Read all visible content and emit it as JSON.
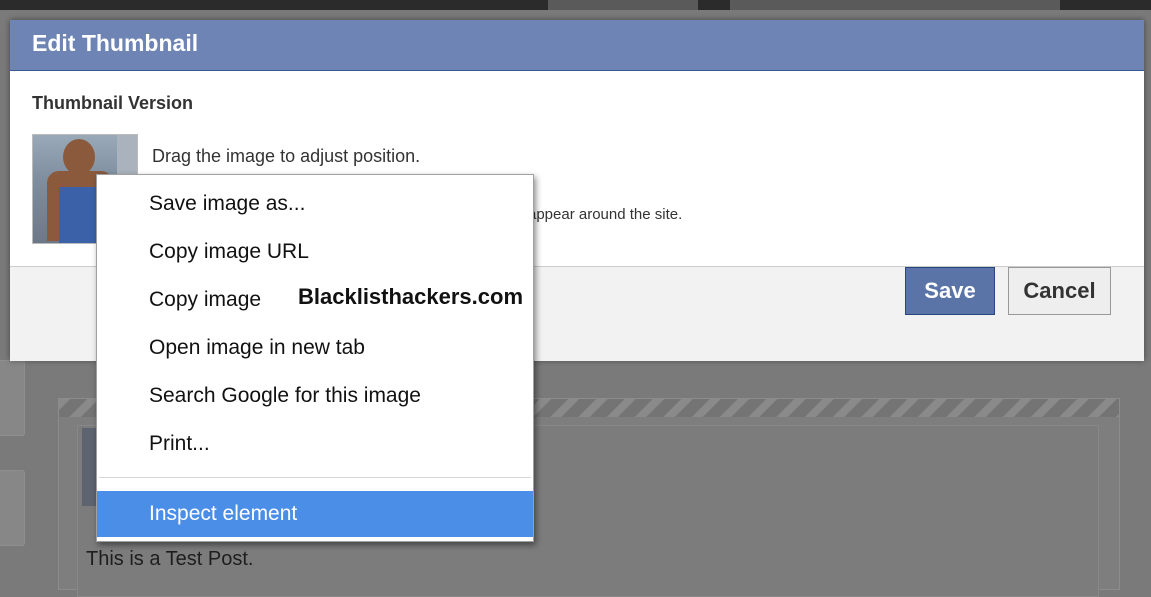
{
  "dialog": {
    "title": "Edit Thumbnail",
    "section_title": "Thumbnail Version",
    "hint_drag": "Drag the image to adjust position.",
    "hint_around": "appear around the site.",
    "save_label": "Save",
    "cancel_label": "Cancel"
  },
  "context_menu": {
    "items": [
      {
        "label": "Save image as..."
      },
      {
        "label": "Copy image URL"
      },
      {
        "label": "Copy image"
      },
      {
        "label": "Open image in new tab"
      },
      {
        "label": "Search Google for this image"
      },
      {
        "label": "Print..."
      },
      {
        "label": "Inspect element"
      }
    ]
  },
  "watermark": "Blacklisthackers.com",
  "post": {
    "text": "This is a Test Post."
  },
  "colors": {
    "header": "#6d84b4",
    "save_button": "#5b74a8",
    "menu_highlight": "#4b8ee8",
    "overlay": "#7a7a7a"
  }
}
